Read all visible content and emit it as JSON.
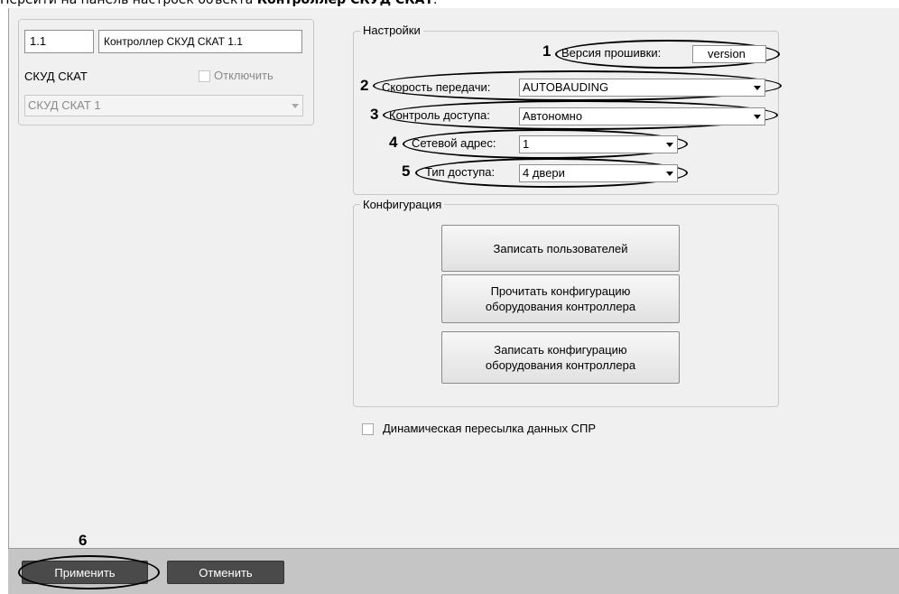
{
  "caption": {
    "prefix": "Перейти на панель настроек объекта ",
    "object": "Контроллер СКУД СКАТ",
    "suffix": "."
  },
  "left": {
    "id_value": "1.1",
    "name_value": "Контроллер СКУД СКАТ 1.1",
    "parent_label": "СКУД СКАТ",
    "disable_label": "Отключить",
    "parent_select_value": "СКУД СКАТ 1"
  },
  "settings": {
    "title": "Настройки",
    "firmware_label": "Версия прошивки:",
    "firmware_value": "version",
    "baud_label": "Скорость передачи:",
    "baud_value": "AUTOBAUDING",
    "access_control_label": "Контроль доступа:",
    "access_control_value": "Автономно",
    "net_address_label": "Сетевой адрес:",
    "net_address_value": "1",
    "access_type_label": "Тип доступа:",
    "access_type_value": "4 двери"
  },
  "config": {
    "title": "Конфигурация",
    "write_users": "Записать пользователей",
    "read_config_line1": "Прочитать конфигурацию",
    "read_config_line2": "оборудования контроллера",
    "write_config_line1": "Записать  конфигурацию",
    "write_config_line2": "оборудования контроллера"
  },
  "dynamic_forwarding_label": "Динамическая пересылка данных СПР",
  "footer": {
    "apply": "Применить",
    "cancel": "Отменить"
  },
  "callouts": [
    "1",
    "2",
    "3",
    "4",
    "5",
    "6"
  ]
}
